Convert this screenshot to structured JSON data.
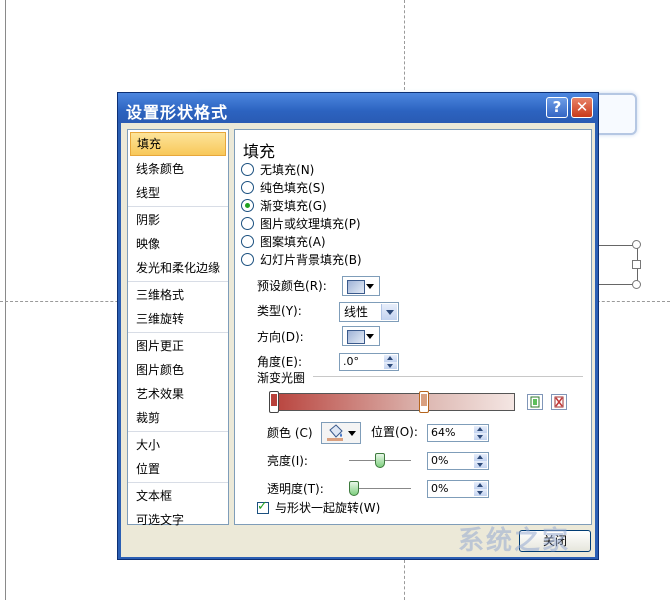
{
  "dialog": {
    "title": "设置形状格式",
    "help_glyph": "?",
    "close_glyph": "✕",
    "close_button_label": "关闭"
  },
  "nav": {
    "groups": [
      [
        "填充",
        "线条颜色",
        "线型"
      ],
      [
        "阴影",
        "映像",
        "发光和柔化边缘"
      ],
      [
        "三维格式",
        "三维旋转"
      ],
      [
        "图片更正",
        "图片颜色",
        "艺术效果",
        "裁剪"
      ],
      [
        "大小",
        "位置"
      ],
      [
        "文本框",
        "可选文字"
      ]
    ],
    "selected": "填充"
  },
  "fill": {
    "heading": "填充",
    "options": [
      {
        "label": "无填充",
        "key": "(N)",
        "selected": false
      },
      {
        "label": "纯色填充",
        "key": "(S)",
        "selected": false
      },
      {
        "label": "渐变填充",
        "key": "(G)",
        "selected": true
      },
      {
        "label": "图片或纹理填充",
        "key": "(P)",
        "selected": false
      },
      {
        "label": "图案填充",
        "key": "(A)",
        "selected": false
      },
      {
        "label": "幻灯片背景填充",
        "key": "(B)",
        "selected": false
      }
    ],
    "preset_label": "预设颜色",
    "preset_key": "(R):",
    "type_label": "类型",
    "type_key": "(Y):",
    "type_value": "线性",
    "direction_label": "方向",
    "direction_key": "(D):",
    "angle_label": "角度",
    "angle_key": "(E):",
    "angle_value": ".0°",
    "gradient_stops_label": "渐变光圈",
    "gradient_stops": [
      {
        "position": 0,
        "color": "#b8413b"
      },
      {
        "position": 64,
        "color": "#d9a080"
      }
    ],
    "color_label": "颜色",
    "color_key": "(C)",
    "position_label": "位置",
    "position_key": "(O):",
    "position_value": "64%",
    "brightness_label": "亮度",
    "brightness_key": "(I):",
    "brightness_value": "0%",
    "brightness_level": 0.5,
    "transparency_label": "透明度",
    "transparency_key": "(T):",
    "transparency_value": "0%",
    "transparency_level": 0,
    "rotate_label": "与形状一起旋转",
    "rotate_key": "(W)",
    "rotate_checked": true
  },
  "watermark": "系统之家"
}
